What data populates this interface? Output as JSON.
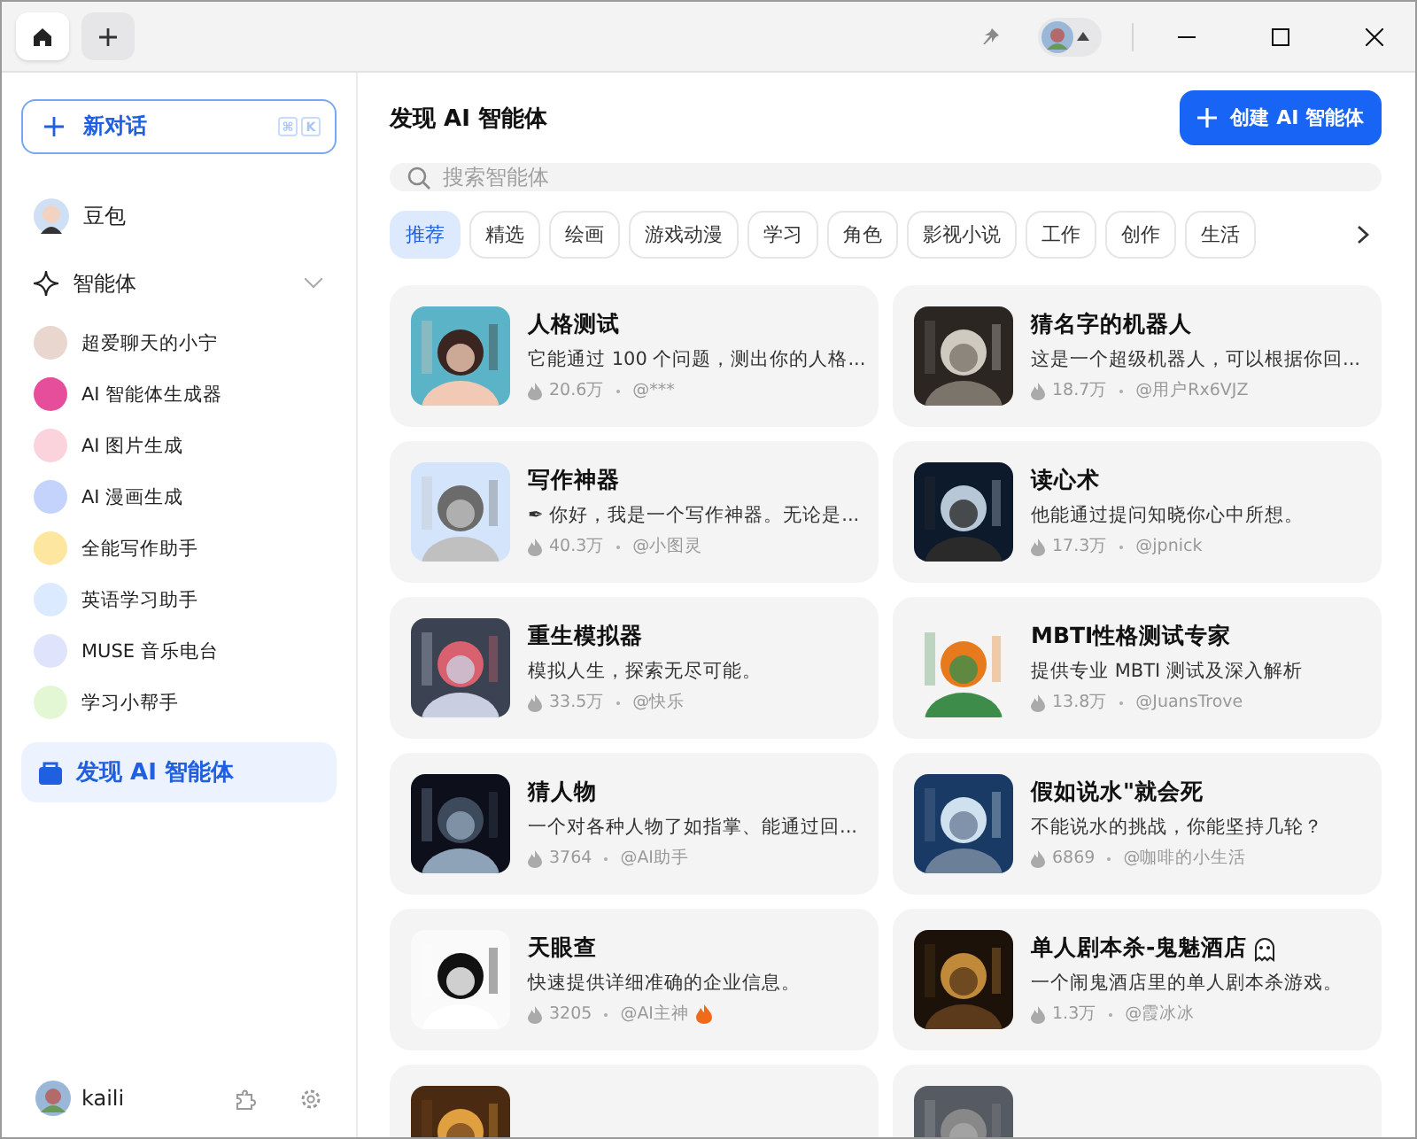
{
  "titlebar": {
    "tabs": [
      {
        "kind": "home",
        "selected": true
      },
      {
        "kind": "new",
        "selected": false
      }
    ]
  },
  "sidebar": {
    "new_chat": {
      "label": "新对话",
      "keys": [
        "⌘",
        "K"
      ]
    },
    "assistant": {
      "label": "豆包"
    },
    "section": {
      "label": "智能体",
      "expanded": true
    },
    "agents": [
      {
        "label": "超爱聊天的小宁",
        "color": "#e8d6cf"
      },
      {
        "label": "AI 智能体生成器",
        "color": "#e64d9a"
      },
      {
        "label": "AI 图片生成",
        "color": "#fbd3dc"
      },
      {
        "label": "AI 漫画生成",
        "color": "#c3d3fb"
      },
      {
        "label": "全能写作助手",
        "color": "#fde6a0"
      },
      {
        "label": "英语学习助手",
        "color": "#dbeafe"
      },
      {
        "label": "MUSE 音乐电台",
        "color": "#dfe3fb"
      },
      {
        "label": "学习小帮手",
        "color": "#e4f7d4"
      }
    ],
    "discover": {
      "label": "发现 AI 智能体",
      "selected": true
    },
    "user": {
      "name": "kaili"
    }
  },
  "main": {
    "title": "发现 AI 智能体",
    "create_button": "创建 AI 智能体",
    "search": {
      "placeholder": "搜索智能体"
    },
    "categories": [
      {
        "label": "推荐",
        "selected": true
      },
      {
        "label": "精选",
        "selected": false
      },
      {
        "label": "绘画",
        "selected": false
      },
      {
        "label": "游戏动漫",
        "selected": false
      },
      {
        "label": "学习",
        "selected": false
      },
      {
        "label": "角色",
        "selected": false
      },
      {
        "label": "影视小说",
        "selected": false
      },
      {
        "label": "工作",
        "selected": false
      },
      {
        "label": "创作",
        "selected": false
      },
      {
        "label": "生活",
        "selected": false
      }
    ],
    "cards": [
      {
        "title": "人格测试",
        "desc": "它能通过 100 个问题，测出你的人格...",
        "count": "20.6万",
        "author": "@***"
      },
      {
        "title": "猜名字的机器人",
        "desc": "这是一个超级机器人，可以根据你回...",
        "count": "18.7万",
        "author": "@用户Rx6VJZ"
      },
      {
        "title": "写作神器",
        "desc": "✒ 你好，我是一个写作神器。无论是...",
        "count": "40.3万",
        "author": "@小图灵"
      },
      {
        "title": "读心术",
        "desc": "他能通过提问知晓你心中所想。",
        "count": "17.3万",
        "author": "@jpnick"
      },
      {
        "title": "重生模拟器",
        "desc": "模拟人生，探索无尽可能。",
        "count": "33.5万",
        "author": "@快乐"
      },
      {
        "title": "MBTI性格测试专家",
        "desc": "提供专业 MBTI 测试及深入解析",
        "count": "13.8万",
        "author": "@JuansTrove"
      },
      {
        "title": "猜人物",
        "desc": "一个对各种人物了如指掌、能通过回...",
        "count": "3764",
        "author": "@AI助手"
      },
      {
        "title": "假如说水\"就会死",
        "desc": "不能说水的挑战，你能坚持几轮？",
        "count": "6869",
        "author": "@咖啡的小生活"
      },
      {
        "title": "天眼查",
        "desc": "快速提供详细准确的企业信息。",
        "count": "3205",
        "author": "@AI主神",
        "author_flame": true
      },
      {
        "title": "单人剧本杀-鬼魅酒店",
        "title_ghost": true,
        "desc": "一个闹鬼酒店里的单人剧本杀游戏。",
        "count": "1.3万",
        "author": "@霞冰冰"
      },
      {
        "kind": "picture"
      },
      {
        "kind": "picture"
      }
    ]
  }
}
